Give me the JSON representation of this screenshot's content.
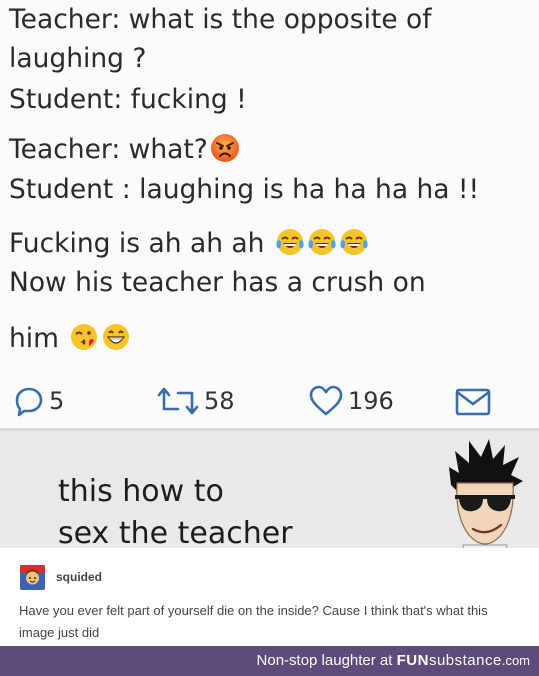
{
  "tweet": {
    "lines": [
      "Teacher: what is the opposite of",
      "laughing ?",
      "Student: fucking !",
      "Teacher: what?",
      "Student : laughing is ha ha ha ha !!",
      "Fucking is ah ah ah",
      "Now his teacher has a crush on",
      "him"
    ],
    "emojis": {
      "angry": "angry-face-emoji",
      "laugh": "tears-of-joy-emoji",
      "kiss": "kissing-face-emoji",
      "grin": "grinning-face-emoji"
    },
    "actions": {
      "replies": "5",
      "retweets": "58",
      "likes": "196"
    }
  },
  "meme": {
    "line1": "this how to",
    "line2": "sex the teacher"
  },
  "comment": {
    "username": "squided",
    "text": "Have you ever felt part of yourself die on the inside? Cause I think that's what this image just did"
  },
  "footer": {
    "prefix": "Non-stop laughter at",
    "brand_fun": "FUN",
    "brand_substance": "substance",
    "brand_tld": ".com"
  },
  "colors": {
    "footer_bg": "#5d4b7b",
    "meme_bg": "#e9e9e9",
    "tweet_bg": "#fbfbfb"
  }
}
